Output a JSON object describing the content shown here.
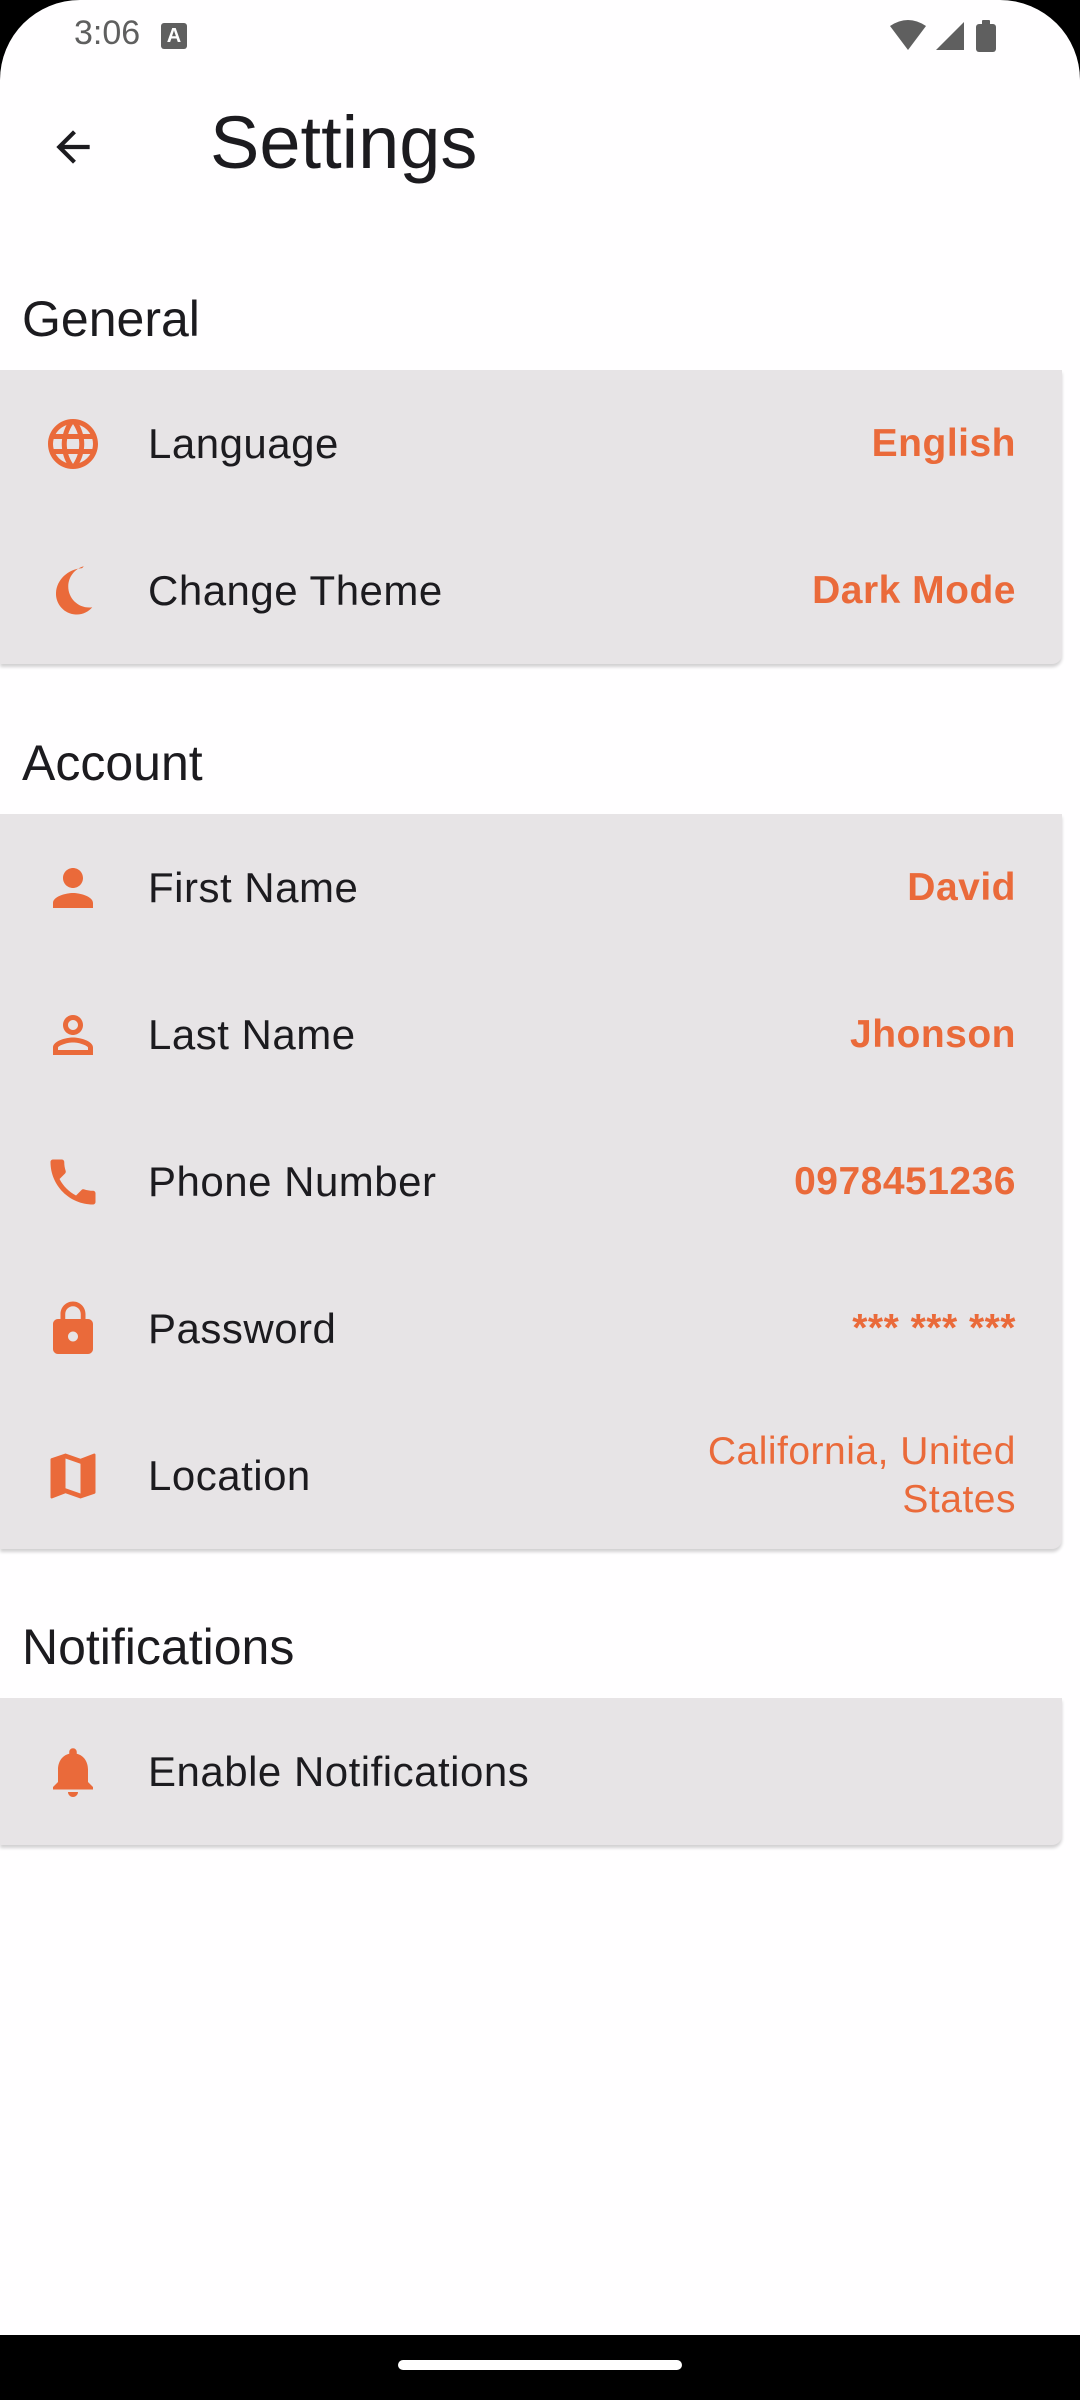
{
  "status_bar": {
    "time": "3:06",
    "notification_badge": "A"
  },
  "app_bar": {
    "title": "Settings"
  },
  "colors": {
    "accent": "#ea6a3a",
    "card": "#e7e4e6",
    "text": "#1c1b1f"
  },
  "sections": [
    {
      "title": "General",
      "items": [
        {
          "icon": "globe-icon",
          "label": "Language",
          "value": "English"
        },
        {
          "icon": "moon-icon",
          "label": "Change Theme",
          "value": "Dark Mode"
        }
      ]
    },
    {
      "title": "Account",
      "items": [
        {
          "icon": "person-filled-icon",
          "label": "First Name",
          "value": "David"
        },
        {
          "icon": "person-outline-icon",
          "label": "Last Name",
          "value": "Jhonson"
        },
        {
          "icon": "phone-icon",
          "label": "Phone Number",
          "value": "0978451236"
        },
        {
          "icon": "lock-icon",
          "label": "Password",
          "value": "*** *** ***"
        },
        {
          "icon": "map-icon",
          "label": "Location",
          "value": "California, United States"
        }
      ]
    },
    {
      "title": "Notifications",
      "items": [
        {
          "icon": "bell-icon",
          "label": "Enable Notifications"
        }
      ]
    }
  ]
}
